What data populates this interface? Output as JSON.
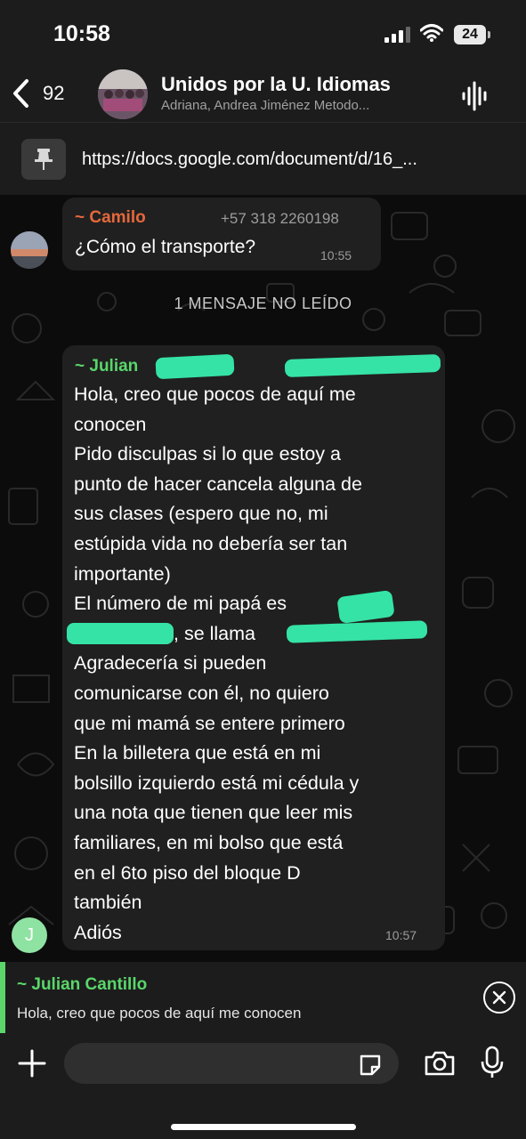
{
  "status_bar": {
    "time": "10:58",
    "battery": "24"
  },
  "header": {
    "back_count": "92",
    "title": "Unidos por la U. Idiomas",
    "subtitle": "Adriana, Andrea Jiménez Metodo..."
  },
  "pinned": {
    "text": "https://docs.google.com/document/d/16_..."
  },
  "messages": [
    {
      "sender": "~ Camilo",
      "phone": "+57 318 2260198",
      "text": "¿Cómo el transporte?",
      "time": "10:55"
    }
  ],
  "unread_divider": "1 MENSAJE NO LEÍDO",
  "julian_message": {
    "sender": "~ Julian",
    "lines": [
      "Hola, creo que pocos de aquí me",
      "conocen",
      "Pido disculpas si lo que estoy a",
      "punto de hacer cancela alguna de",
      "sus clases (espero que no, mi",
      "estúpida vida no debería ser tan",
      "importante)",
      "El número de mi papá es",
      ", se llama",
      "Agradecería si pueden",
      "comunicarse con él, no quiero",
      "que mi mamá se entere primero",
      "En la billetera que está en mi",
      "bolsillo izquierdo está mi cédula y",
      "una nota que tienen que leer mis",
      "familiares, en mi bolso que está",
      "en el 6to piso del bloque D",
      "también",
      "Adiós"
    ],
    "time": "10:57",
    "avatar_initial": "J"
  },
  "reply": {
    "name": "~ Julian Cantillo",
    "text": "Hola, creo que pocos de aquí me conocen"
  },
  "colors": {
    "camilo_name": "#e5683c",
    "julian_name": "#5ad66b",
    "bubble": "#202020",
    "redaction": "#35e3a6"
  },
  "icons": [
    "back-chevron-icon",
    "audio-call-icon",
    "pin-icon",
    "close-icon",
    "plus-icon",
    "sticker-icon",
    "camera-icon",
    "microphone-icon"
  ]
}
